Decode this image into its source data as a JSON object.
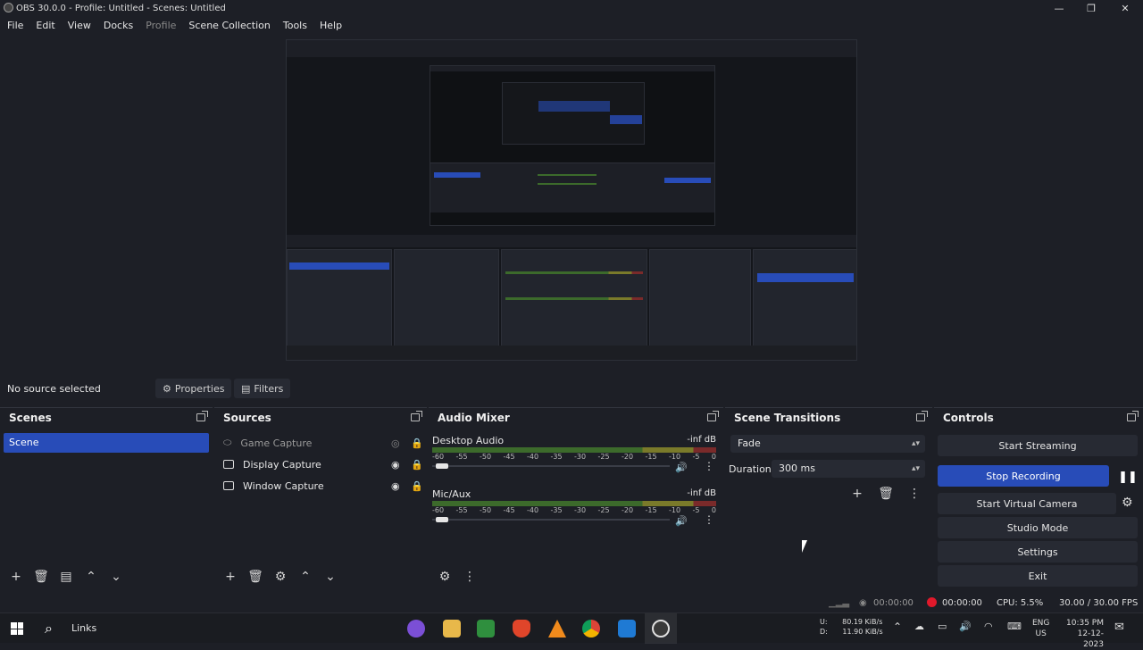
{
  "window": {
    "title": "OBS 30.0.0 - Profile: Untitled - Scenes: Untitled"
  },
  "menu": {
    "items": [
      "File",
      "Edit",
      "View",
      "Docks",
      "Profile",
      "Scene Collection",
      "Tools",
      "Help"
    ]
  },
  "source_bar": {
    "no_source": "No source selected",
    "properties": "Properties",
    "filters": "Filters"
  },
  "scenes": {
    "title": "Scenes",
    "items": [
      "Scene"
    ]
  },
  "sources": {
    "title": "Sources",
    "items": [
      "Game Capture",
      "Display Capture",
      "Window Capture"
    ]
  },
  "mixer": {
    "title": "Audio Mixer",
    "channels": [
      {
        "name": "Desktop Audio",
        "level": "-inf dB"
      },
      {
        "name": "Mic/Aux",
        "level": "-inf dB"
      }
    ],
    "ticks": [
      "-60",
      "-55",
      "-50",
      "-45",
      "-40",
      "-35",
      "-30",
      "-25",
      "-20",
      "-15",
      "-10",
      "-5",
      "0"
    ]
  },
  "transitions": {
    "title": "Scene Transitions",
    "type": "Fade",
    "duration_label": "Duration",
    "duration_value": "300 ms"
  },
  "controls": {
    "title": "Controls",
    "start_streaming": "Start Streaming",
    "stop_recording": "Stop Recording",
    "start_virtual_camera": "Start Virtual Camera",
    "studio_mode": "Studio Mode",
    "settings": "Settings",
    "exit": "Exit"
  },
  "status": {
    "stream_time": "00:00:00",
    "rec_time": "00:00:00",
    "cpu": "CPU: 5.5%",
    "fps": "30.00 / 30.00 FPS"
  },
  "taskbar": {
    "search": "Links",
    "net_up_label": "U:",
    "net_up": "80.19 KiB/s",
    "net_down_label": "D:",
    "net_down": "11.90 KiB/s",
    "lang": "ENG",
    "region": "US",
    "time": "10:35 PM",
    "date": "12-12-2023"
  },
  "colors": {
    "accent": "#284cb8",
    "background": "#1d1f26",
    "panel": "#272a33",
    "recording": "#e0192b"
  }
}
